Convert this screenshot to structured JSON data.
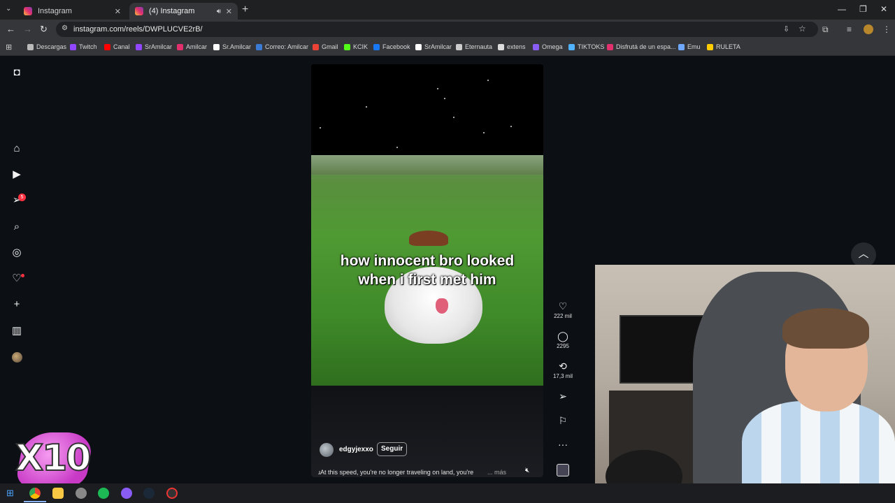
{
  "browser": {
    "tabs": [
      {
        "label": "Instagram"
      },
      {
        "label": "(4) Instagram"
      }
    ],
    "url": "instagram.com/reels/DWPLUCVE2rB/",
    "bookmarks": [
      {
        "label": "Descargas",
        "color": "#bbbbbb"
      },
      {
        "label": "Twitch",
        "color": "#9146ff"
      },
      {
        "label": "Canal",
        "color": "#ff0000"
      },
      {
        "label": "SrAmilcar",
        "color": "#9146ff"
      },
      {
        "label": "Amilcar",
        "color": "#e1306c"
      },
      {
        "label": "Sr.Amilcar",
        "color": "#ffffff"
      },
      {
        "label": "Correo: Amilcar",
        "color": "#3a7bd5"
      },
      {
        "label": "Gmail",
        "color": "#ea4335"
      },
      {
        "label": "KCIK",
        "color": "#53fc18"
      },
      {
        "label": "Facebook",
        "color": "#1877f2"
      },
      {
        "label": "SrAmilcar",
        "color": "#ffffff"
      },
      {
        "label": "Eternauta",
        "color": "#cccccc"
      },
      {
        "label": "extens",
        "color": "#dddddd"
      },
      {
        "label": "Omega",
        "color": "#8a5cf6"
      },
      {
        "label": "TIKTOKS",
        "color": "#4fb3ff"
      },
      {
        "label": "Disfrutá de un espa...",
        "color": "#e1306c"
      },
      {
        "label": "Emu",
        "color": "#6ea8ff"
      },
      {
        "label": "RULETA",
        "color": "#ffcc00"
      }
    ]
  },
  "sidebar": {
    "notification_count": "5"
  },
  "reel": {
    "caption_line1": "how innocent bro looked",
    "caption_line2": "when i first met him",
    "username": "edgyjexxo",
    "follow_label": "Seguir",
    "description": "ɹAt this speed, you're no longer traveling on land, you're",
    "more_label": "... más",
    "likes": "222 mil",
    "comments": "2295",
    "reposts": "17,3 mil"
  },
  "overlay": {
    "sticker_text": "X10"
  }
}
